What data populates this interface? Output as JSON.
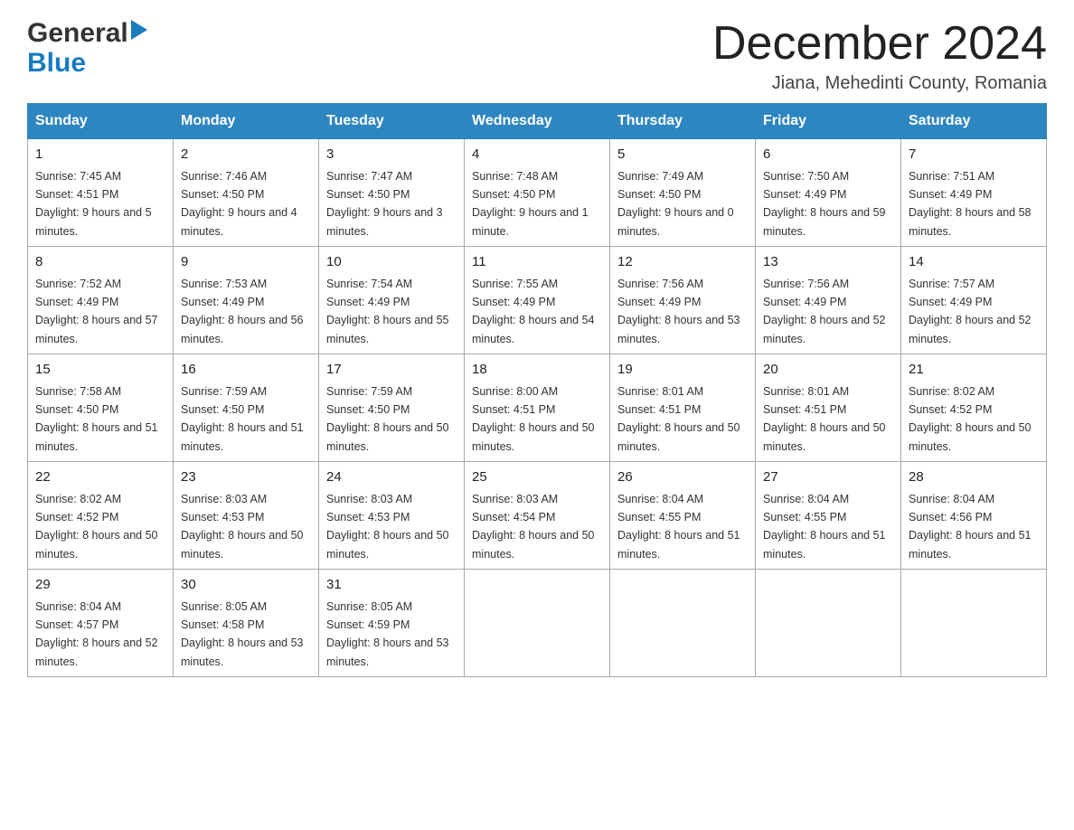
{
  "header": {
    "month_title": "December 2024",
    "location": "Jiana, Mehedinti County, Romania"
  },
  "days_of_week": [
    "Sunday",
    "Monday",
    "Tuesday",
    "Wednesday",
    "Thursday",
    "Friday",
    "Saturday"
  ],
  "weeks": [
    [
      {
        "day": "1",
        "sunrise": "7:45 AM",
        "sunset": "4:51 PM",
        "daylight": "9 hours and 5 minutes."
      },
      {
        "day": "2",
        "sunrise": "7:46 AM",
        "sunset": "4:50 PM",
        "daylight": "9 hours and 4 minutes."
      },
      {
        "day": "3",
        "sunrise": "7:47 AM",
        "sunset": "4:50 PM",
        "daylight": "9 hours and 3 minutes."
      },
      {
        "day": "4",
        "sunrise": "7:48 AM",
        "sunset": "4:50 PM",
        "daylight": "9 hours and 1 minute."
      },
      {
        "day": "5",
        "sunrise": "7:49 AM",
        "sunset": "4:50 PM",
        "daylight": "9 hours and 0 minutes."
      },
      {
        "day": "6",
        "sunrise": "7:50 AM",
        "sunset": "4:49 PM",
        "daylight": "8 hours and 59 minutes."
      },
      {
        "day": "7",
        "sunrise": "7:51 AM",
        "sunset": "4:49 PM",
        "daylight": "8 hours and 58 minutes."
      }
    ],
    [
      {
        "day": "8",
        "sunrise": "7:52 AM",
        "sunset": "4:49 PM",
        "daylight": "8 hours and 57 minutes."
      },
      {
        "day": "9",
        "sunrise": "7:53 AM",
        "sunset": "4:49 PM",
        "daylight": "8 hours and 56 minutes."
      },
      {
        "day": "10",
        "sunrise": "7:54 AM",
        "sunset": "4:49 PM",
        "daylight": "8 hours and 55 minutes."
      },
      {
        "day": "11",
        "sunrise": "7:55 AM",
        "sunset": "4:49 PM",
        "daylight": "8 hours and 54 minutes."
      },
      {
        "day": "12",
        "sunrise": "7:56 AM",
        "sunset": "4:49 PM",
        "daylight": "8 hours and 53 minutes."
      },
      {
        "day": "13",
        "sunrise": "7:56 AM",
        "sunset": "4:49 PM",
        "daylight": "8 hours and 52 minutes."
      },
      {
        "day": "14",
        "sunrise": "7:57 AM",
        "sunset": "4:49 PM",
        "daylight": "8 hours and 52 minutes."
      }
    ],
    [
      {
        "day": "15",
        "sunrise": "7:58 AM",
        "sunset": "4:50 PM",
        "daylight": "8 hours and 51 minutes."
      },
      {
        "day": "16",
        "sunrise": "7:59 AM",
        "sunset": "4:50 PM",
        "daylight": "8 hours and 51 minutes."
      },
      {
        "day": "17",
        "sunrise": "7:59 AM",
        "sunset": "4:50 PM",
        "daylight": "8 hours and 50 minutes."
      },
      {
        "day": "18",
        "sunrise": "8:00 AM",
        "sunset": "4:51 PM",
        "daylight": "8 hours and 50 minutes."
      },
      {
        "day": "19",
        "sunrise": "8:01 AM",
        "sunset": "4:51 PM",
        "daylight": "8 hours and 50 minutes."
      },
      {
        "day": "20",
        "sunrise": "8:01 AM",
        "sunset": "4:51 PM",
        "daylight": "8 hours and 50 minutes."
      },
      {
        "day": "21",
        "sunrise": "8:02 AM",
        "sunset": "4:52 PM",
        "daylight": "8 hours and 50 minutes."
      }
    ],
    [
      {
        "day": "22",
        "sunrise": "8:02 AM",
        "sunset": "4:52 PM",
        "daylight": "8 hours and 50 minutes."
      },
      {
        "day": "23",
        "sunrise": "8:03 AM",
        "sunset": "4:53 PM",
        "daylight": "8 hours and 50 minutes."
      },
      {
        "day": "24",
        "sunrise": "8:03 AM",
        "sunset": "4:53 PM",
        "daylight": "8 hours and 50 minutes."
      },
      {
        "day": "25",
        "sunrise": "8:03 AM",
        "sunset": "4:54 PM",
        "daylight": "8 hours and 50 minutes."
      },
      {
        "day": "26",
        "sunrise": "8:04 AM",
        "sunset": "4:55 PM",
        "daylight": "8 hours and 51 minutes."
      },
      {
        "day": "27",
        "sunrise": "8:04 AM",
        "sunset": "4:55 PM",
        "daylight": "8 hours and 51 minutes."
      },
      {
        "day": "28",
        "sunrise": "8:04 AM",
        "sunset": "4:56 PM",
        "daylight": "8 hours and 51 minutes."
      }
    ],
    [
      {
        "day": "29",
        "sunrise": "8:04 AM",
        "sunset": "4:57 PM",
        "daylight": "8 hours and 52 minutes."
      },
      {
        "day": "30",
        "sunrise": "8:05 AM",
        "sunset": "4:58 PM",
        "daylight": "8 hours and 53 minutes."
      },
      {
        "day": "31",
        "sunrise": "8:05 AM",
        "sunset": "4:59 PM",
        "daylight": "8 hours and 53 minutes."
      },
      null,
      null,
      null,
      null
    ]
  ],
  "labels": {
    "sunrise": "Sunrise:",
    "sunset": "Sunset:",
    "daylight": "Daylight:"
  }
}
